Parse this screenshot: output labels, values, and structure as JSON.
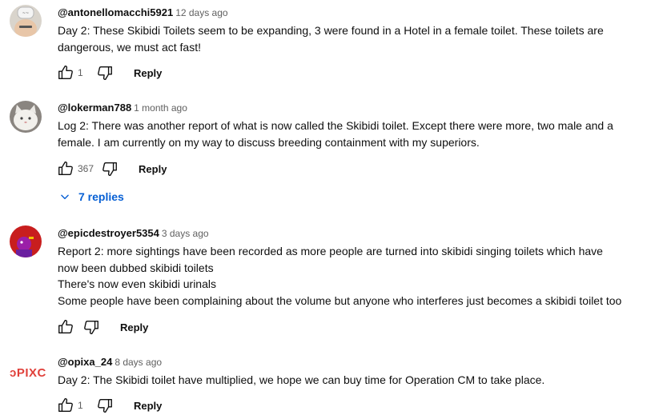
{
  "comments": [
    {
      "author": "@antonellomacchi5921",
      "time": "12 days ago",
      "lines": [
        "Day 2: These Skibidi Toilets seem to be expanding, 3 were found in a Hotel in a female toilet. These toilets are",
        "dangerous, we must act fast!"
      ],
      "likes": "1",
      "reply_label": "Reply"
    },
    {
      "author": "@lokerman788",
      "time": "1 month ago",
      "lines": [
        "Log 2: There was another report of what is now called the Skibidi toilet. Except there were more, two male and a",
        "female. I am currently on my way to discuss breeding containment with my superiors."
      ],
      "likes": "367",
      "reply_label": "Reply",
      "replies_label": "7 replies"
    },
    {
      "author": "@epicdestroyer5354",
      "time": "3 days ago",
      "lines": [
        "Report 2: more sightings have been recorded as more people are turned into skibidi singing toilets which have",
        "now been dubbed skibidi toilets",
        "There's now even skibidi urinals",
        "Some people have been complaining about the volume but anyone who interferes just becomes a skibidi toilet too"
      ],
      "likes": "",
      "reply_label": "Reply"
    },
    {
      "author": "@opixa_24",
      "time": "8 days ago",
      "avatar_text": "ɔPIXC",
      "lines": [
        "Day 2: The Skibidi toilet have multiplied, we hope we can buy time for Operation CM to take place."
      ],
      "likes": "1",
      "reply_label": "Reply"
    }
  ],
  "colors": {
    "link_blue": "#065fd4",
    "secondary_text": "#606060",
    "brand_red": "#e0403a"
  },
  "icons": [
    "thumb-up-icon",
    "thumb-down-icon",
    "chevron-down-icon"
  ]
}
